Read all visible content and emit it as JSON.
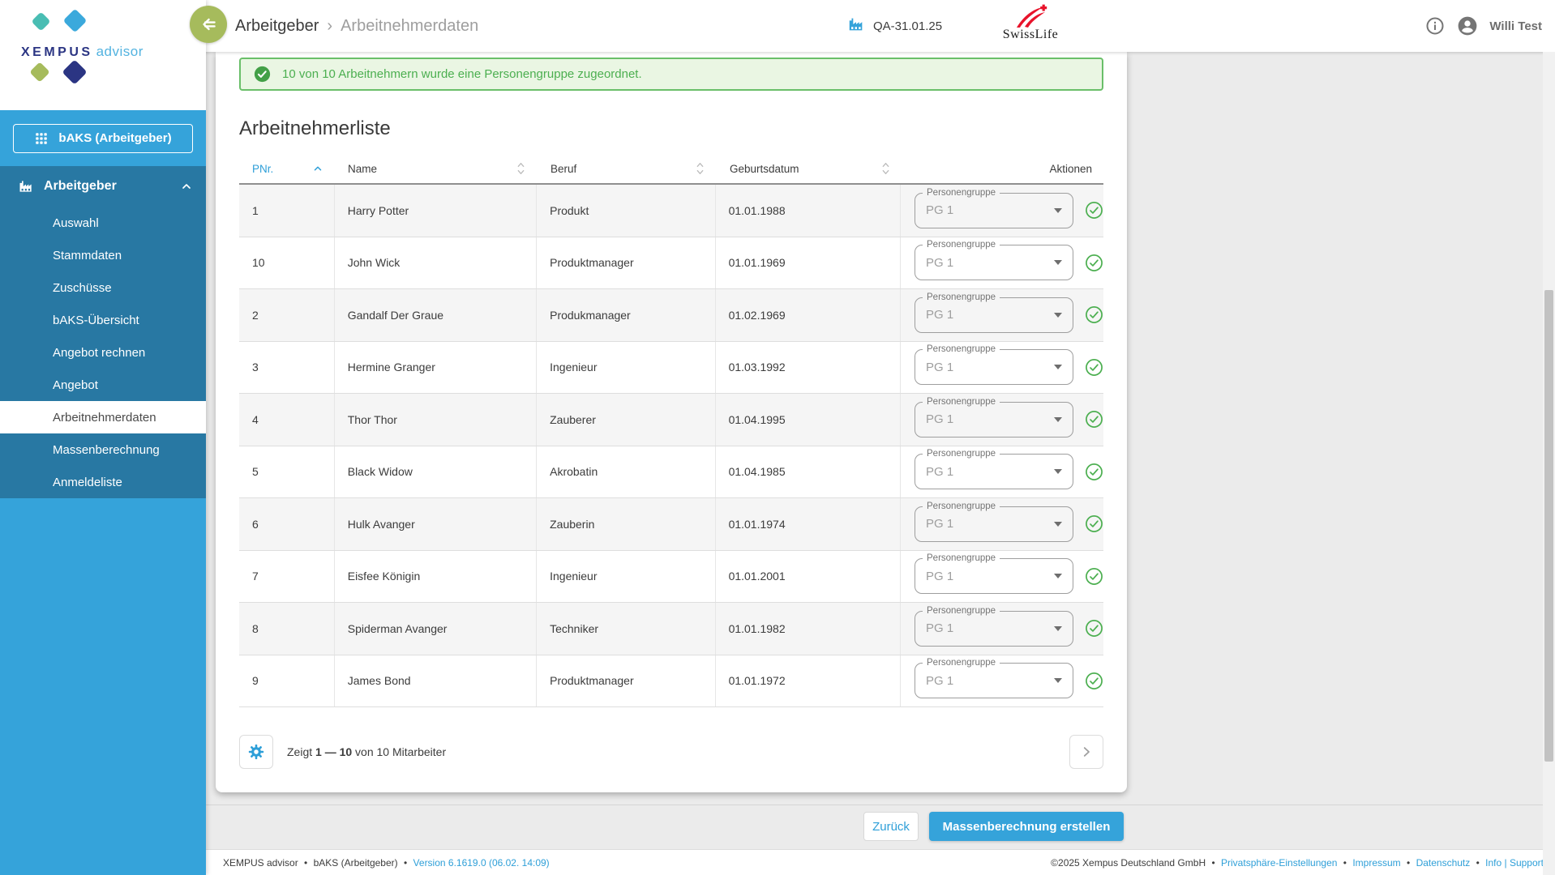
{
  "brand": {
    "wordmark": "XEMPUS",
    "product": "advisor"
  },
  "header": {
    "breadcrumb_root": "Arbeitgeber",
    "breadcrumb_separator": "›",
    "breadcrumb_current": "Arbeitnehmerdaten",
    "employer_tag": "QA-31.01.25",
    "partner_name": "SwissLife",
    "user_name": "Willi Test"
  },
  "sidebar": {
    "workspace_button": "bAKS (Arbeitgeber)",
    "section_label": "Arbeitgeber",
    "items": [
      {
        "label": "Auswahl",
        "active": false
      },
      {
        "label": "Stammdaten",
        "active": false
      },
      {
        "label": "Zuschüsse",
        "active": false
      },
      {
        "label": "bAKS-Übersicht",
        "active": false
      },
      {
        "label": "Angebot rechnen",
        "active": false
      },
      {
        "label": "Angebot",
        "active": false
      },
      {
        "label": "Arbeitnehmerdaten",
        "active": true
      },
      {
        "label": "Massenberechnung",
        "active": false
      },
      {
        "label": "Anmeldeliste",
        "active": false
      }
    ]
  },
  "main": {
    "success_message": "10 von 10 Arbeitnehmern wurde eine Personengruppe zugeordnet.",
    "title": "Arbeitnehmerliste",
    "table": {
      "columns": [
        "PNr.",
        "Name",
        "Beruf",
        "Geburtsdatum",
        "Aktionen"
      ],
      "sorted_column": "PNr.",
      "sort_direction": "asc",
      "select_label": "Personengruppe",
      "rows": [
        {
          "pnr": "1",
          "name": "Harry Potter",
          "beruf": "Produkt",
          "geburtsdatum": "01.01.1988",
          "personengruppe": "PG 1"
        },
        {
          "pnr": "10",
          "name": "John Wick",
          "beruf": "Produktmanager",
          "geburtsdatum": "01.01.1969",
          "personengruppe": "PG 1"
        },
        {
          "pnr": "2",
          "name": "Gandalf Der Graue",
          "beruf": "Produkmanager",
          "geburtsdatum": "01.02.1969",
          "personengruppe": "PG 1"
        },
        {
          "pnr": "3",
          "name": "Hermine Granger",
          "beruf": "Ingenieur",
          "geburtsdatum": "01.03.1992",
          "personengruppe": "PG 1"
        },
        {
          "pnr": "4",
          "name": "Thor Thor",
          "beruf": "Zauberer",
          "geburtsdatum": "01.04.1995",
          "personengruppe": "PG 1"
        },
        {
          "pnr": "5",
          "name": "Black Widow",
          "beruf": "Akrobatin",
          "geburtsdatum": "01.04.1985",
          "personengruppe": "PG 1"
        },
        {
          "pnr": "6",
          "name": "Hulk Avanger",
          "beruf": "Zauberin",
          "geburtsdatum": "01.01.1974",
          "personengruppe": "PG 1"
        },
        {
          "pnr": "7",
          "name": "Eisfee Königin",
          "beruf": "Ingenieur",
          "geburtsdatum": "01.01.2001",
          "personengruppe": "PG 1"
        },
        {
          "pnr": "8",
          "name": "Spiderman Avanger",
          "beruf": "Techniker",
          "geburtsdatum": "01.01.1982",
          "personengruppe": "PG 1"
        },
        {
          "pnr": "9",
          "name": "James Bond",
          "beruf": "Produktmanager",
          "geburtsdatum": "01.01.1972",
          "personengruppe": "PG 1"
        }
      ],
      "pagination": {
        "prefix": "Zeigt",
        "range": "1 — 10",
        "suffix": "von 10 Mitarbeiter"
      }
    }
  },
  "actions": {
    "back": "Zurück",
    "submit": "Massenberechnung erstellen"
  },
  "footer": {
    "separator": "•",
    "left_app": "XEMPUS advisor",
    "left_workspace": "bAKS (Arbeitgeber)",
    "version_link": "Version 6.1619.0 (06.02. 14:09)",
    "copyright": "©2025 Xempus Deutschland GmbH",
    "links": [
      "Privatsphäre-Einstellungen",
      "Impressum",
      "Datenschutz",
      "Info | Support"
    ]
  },
  "icons": {
    "collapse": "double-left-arrow",
    "factory": "factory-building",
    "grid": "3x3-apps-grid",
    "success_check": "filled-green-circle-check",
    "row_check": "outlined-green-circle-check",
    "gear": "settings-gear",
    "info": "info-circle",
    "account": "person-circle"
  },
  "colors": {
    "accent_blue": "#35a3da",
    "sidebar_dark_blue": "#2878a3",
    "olive_green": "#a6bb5c",
    "success_green": "#4caf50",
    "banner_bg": "#eaf6e3",
    "navy": "#2b3583",
    "swisslife_red": "#e8132b",
    "text_dark": "#3c3c3c",
    "text_grey": "#757575"
  }
}
